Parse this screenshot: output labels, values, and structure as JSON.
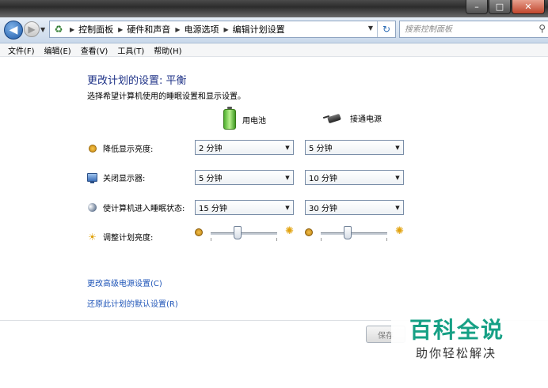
{
  "window": {
    "controls": {
      "minimize": "–",
      "maximize": "□",
      "close": "✕"
    }
  },
  "nav": {
    "back_icon": "arrow-left-icon",
    "forward_icon": "arrow-right-icon",
    "breadcrumbs": [
      "控制面板",
      "硬件和声音",
      "电源选项",
      "编辑计划设置"
    ],
    "search_placeholder": "搜索控制面板"
  },
  "menu": [
    "文件(F)",
    "编辑(E)",
    "查看(V)",
    "工具(T)",
    "帮助(H)"
  ],
  "page": {
    "title": "更改计划的设置: 平衡",
    "subtitle": "选择希望计算机使用的睡眠设置和显示设置。"
  },
  "columns": {
    "battery": "用电池",
    "plugged": "接通电源"
  },
  "settings": [
    {
      "label": "降低显示亮度:",
      "icon": "dim-display-icon",
      "battery": "2 分钟",
      "plugged": "5 分钟"
    },
    {
      "label": "关闭显示器:",
      "icon": "monitor-icon",
      "battery": "5 分钟",
      "plugged": "10 分钟"
    },
    {
      "label": "使计算机进入睡眠状态:",
      "icon": "sleep-moon-icon",
      "battery": "15 分钟",
      "plugged": "30 分钟"
    }
  ],
  "brightness": {
    "label": "调整计划亮度:",
    "battery_level": 0.4,
    "plugged_level": 0.4
  },
  "links": {
    "advanced": "更改高级电源设置(C)",
    "restore": "还原此计划的默认设置(R)"
  },
  "buttons": {
    "save": "保存"
  },
  "watermark": {
    "logo": "百科全说",
    "tagline": "助你轻松解决"
  },
  "colors": {
    "title_blue": "#1e3287",
    "link_blue": "#1f55b8",
    "watermark_green": "#16a085"
  }
}
